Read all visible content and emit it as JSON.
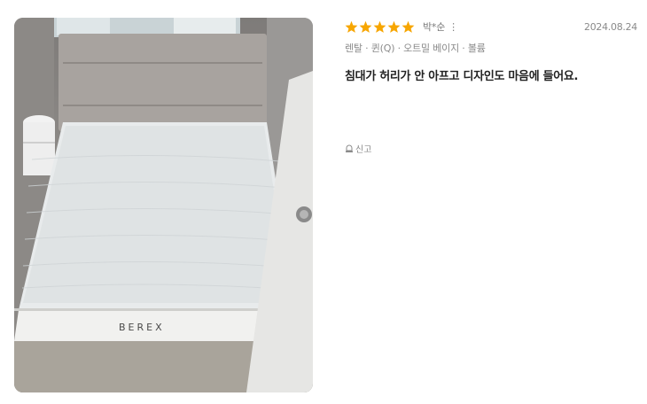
{
  "review": {
    "rating": 5,
    "rating_max": 5,
    "reviewer": "박*순",
    "more_icon": "⋮",
    "date": "2024.08.24",
    "options": "렌탈 · 퀸(Q) · 오트밀 베이지 · 볼륨",
    "text": "침대가 허리가 안 아프고 디자인도 마음에 들어요.",
    "report_label": "신고",
    "photo_brand": "BEREX"
  },
  "colors": {
    "star": "#f7a600",
    "text_primary": "#222222",
    "text_muted": "#8a8a8a"
  },
  "icons": {
    "star": "star-icon",
    "more": "more-vertical-icon",
    "report": "siren-icon"
  }
}
